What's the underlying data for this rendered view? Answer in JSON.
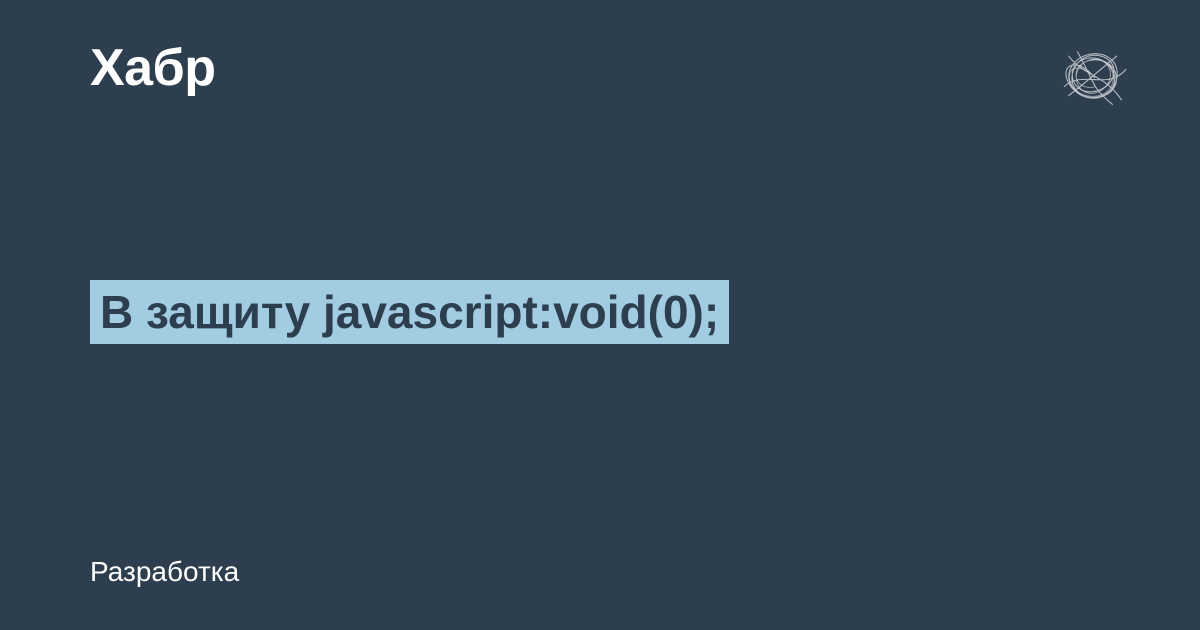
{
  "site_name": "Хабр",
  "article_title": "В защиту javascript:void(0);",
  "category": "Разработка",
  "colors": {
    "background": "#2d3e4e",
    "highlight": "#a1cce1",
    "text_light": "#ffffff"
  }
}
